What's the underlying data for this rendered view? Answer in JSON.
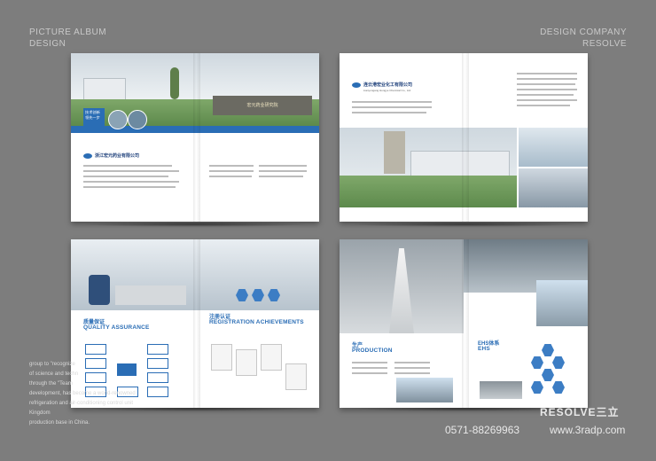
{
  "corner_left": {
    "line1": "PICTURE ALBUM",
    "line2": "DESIGN"
  },
  "corner_right": {
    "line1": "DESIGN COMPANY",
    "line2": "RESOLVE"
  },
  "spread1": {
    "company": "浙江宏元药业有限公司",
    "badge": "技术创新 领先一步",
    "sign": "宏元药业研究院"
  },
  "spread2": {
    "company": "连云港宏业化工有限公司",
    "subtitle": "Lianyungang Hongye Chemical Co., Ltd."
  },
  "spread3": {
    "qa_zh": "质量保证",
    "qa_en": "QUALITY ASSURANCE",
    "reg_zh": "注册认证",
    "reg_en": "REGISTRATION ACHIEVEMENTS"
  },
  "spread4": {
    "prod_zh": "生产",
    "prod_en": "PRODUCTION",
    "ehs_zh": "EHS体系",
    "ehs_en": "EHS"
  },
  "side_text": [
    "group to \"recognize",
    "of science and techn",
    "through the \"Team",
    "development, has become a world-renowned",
    "refrigeration and air-conditioning control unit Kingdom",
    "production base in China."
  ],
  "footer": {
    "brand": "RESOLVE三立",
    "phone": "0571-88269963",
    "site": "www.3radp.com"
  }
}
